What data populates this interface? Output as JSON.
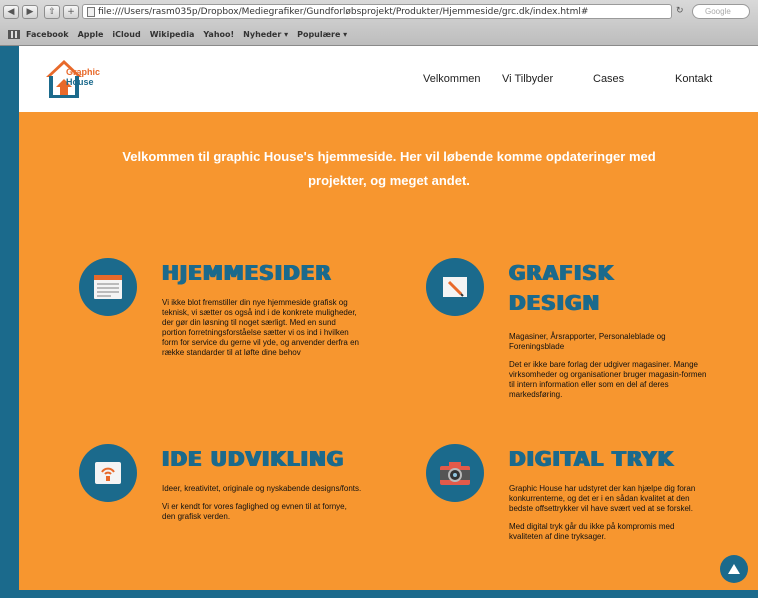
{
  "browser": {
    "url": "file:///Users/rasm035p/Dropbox/Mediegrafiker/Gundforløbsprojekt/Produkter/Hjemmeside/grc.dk/index.html#",
    "search_placeholder": "Google",
    "bookmarks": [
      "Facebook",
      "Apple",
      "iCloud",
      "Wikipedia",
      "Yahoo!",
      "Nyheder ▾",
      "Populære ▾"
    ]
  },
  "site": {
    "logo": {
      "line1": "Graphic",
      "line2": "House"
    },
    "nav": [
      "Velkommen",
      "Vi Tilbyder",
      "Cases",
      "Kontakt"
    ],
    "intro": "Velkommen til graphic House's hjemmeside. Her vil løbende komme opdateringer med projekter, og meget andet.",
    "services": [
      {
        "icon": "website-icon",
        "title": "Hjemmesider",
        "paragraphs": [
          "Vi ikke blot fremstiller din nye hjemmeside grafisk og teknisk, vi sætter os også ind i de konkrete muligheder, der gør din løsning til noget særligt. Med en sund portion forretningsforståelse sætter vi os ind i hvilken form for service du gerne vil yde, og anvender derfra en række standarder til at løfte dine behov"
        ]
      },
      {
        "icon": "pencil-icon",
        "title": "Grafisk design",
        "paragraphs": [
          "Magasiner, Årsrapporter, Personaleblade og Foreningsblade",
          "Det er ikke bare forlag der udgiver magasiner. Mange virksomheder og organisationer bruger magasin-formen til intern information eller som en del af deres markedsføring."
        ]
      },
      {
        "icon": "idea-icon",
        "title": "Ide udvikling",
        "paragraphs": [
          "Ideer, kreativitet, originale og nyskabende designs/fonts.",
          "Vi er kendt for vores faglighed og evnen til at fornye, den grafisk verden."
        ]
      },
      {
        "icon": "camera-icon",
        "title": "Digital tryk",
        "paragraphs": [
          "Graphic House har udstyret der kan hjælpe dig foran konkurrenterne, og det er i en sådan kvalitet at den bedste offsettrykker vil have svært ved at se forskel.",
          "Med digital tryk går du ikke på kompromis med kvaliteten af dine tryksager."
        ]
      }
    ]
  },
  "colors": {
    "accent_orange": "#f7962f",
    "brand_blue": "#1b6a8c"
  }
}
